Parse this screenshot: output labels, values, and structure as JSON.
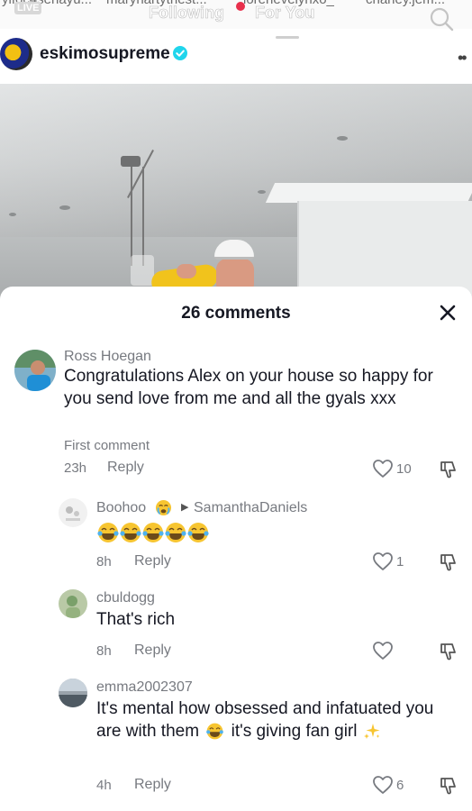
{
  "top_bar": {
    "story_names": [
      "ylfoc4senayu...",
      "maryhartythest...",
      "lorenevelynxo_",
      "charley.jem..."
    ],
    "live_badge": "LIVE",
    "tabs": [
      {
        "label": "Following",
        "active": false
      },
      {
        "label": "For You",
        "active": true
      }
    ]
  },
  "post": {
    "username": "eskimosupreme",
    "verified": true
  },
  "comments_sheet": {
    "title": "26 comments",
    "comments": [
      {
        "user": "Ross Hoegan",
        "text": "Congratulations Alex on your house so happy for you send love from me and all the gyals xxx",
        "badge": "First comment",
        "time": "23h",
        "reply_label": "Reply",
        "likes": "10"
      },
      {
        "user": "Boohoo",
        "reply_to": "SamanthaDaniels",
        "text": "😂😂😂😂😂",
        "time": "8h",
        "reply_label": "Reply",
        "likes": "1"
      },
      {
        "user": "cbuldogg",
        "text": "That's rich",
        "time": "8h",
        "reply_label": "Reply",
        "likes": ""
      },
      {
        "user": "emma2002307",
        "text_before": "It's mental how obsessed and infatuated you are with them",
        "text_after": "it's giving fan girl",
        "time": "4h",
        "reply_label": "Reply",
        "likes": "6"
      }
    ]
  },
  "icons": {
    "search": "search-icon",
    "verified": "verified-badge-icon",
    "close": "close-icon",
    "like": "heart-outline-icon",
    "dislike": "thumbs-down-icon",
    "crying": "crying-face-emoji",
    "laughing": "tears-of-joy-emoji",
    "sparkles": "sparkles-emoji"
  },
  "colors": {
    "text_primary": "#161823",
    "text_secondary": "#777a80",
    "verified_blue": "#20d5ec",
    "live_dot": "#e8304c",
    "emoji_yellow": "#f7c531"
  }
}
